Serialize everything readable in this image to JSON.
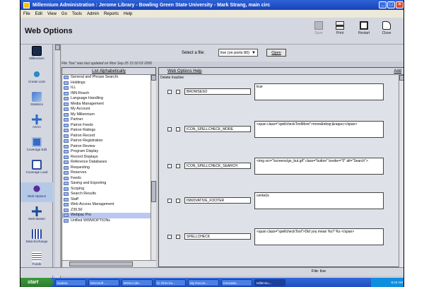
{
  "window": {
    "title": "Millennium Administration : Jerome Library - Bowling Green State University - Mark Strang, main circ"
  },
  "menu": [
    "File",
    "Edit",
    "View",
    "Go",
    "Tools",
    "Admin",
    "Reports",
    "Help"
  ],
  "header": {
    "page_title": "Web Options",
    "toolbar": [
      {
        "label": "Save",
        "icon": "save-icon",
        "enabled": false
      },
      {
        "label": "Print",
        "icon": "print-icon",
        "enabled": true
      },
      {
        "label": "Restart",
        "icon": "restart-icon",
        "enabled": true
      },
      {
        "label": "Close",
        "icon": "close-icon",
        "enabled": true
      }
    ]
  },
  "leftnav": [
    {
      "label": "Millennium",
      "icon": "millennium-logo-icon"
    },
    {
      "label": "Create Lists",
      "icon": "create-lists-icon"
    },
    {
      "label": "Statistics",
      "icon": "statistics-icon"
    },
    {
      "label": "ASAA",
      "icon": "asaa-icon"
    },
    {
      "label": "Coverage Edit",
      "icon": "coverage-edit-icon"
    },
    {
      "label": "Coverage Load",
      "icon": "coverage-load-icon"
    },
    {
      "label": "Web Options",
      "icon": "web-options-icon",
      "active": true
    },
    {
      "label": "Web Master",
      "icon": "web-master-icon"
    },
    {
      "label": "Data Exchange",
      "icon": "data-exchange-icon"
    },
    {
      "label": "Funds",
      "icon": "funds-icon"
    }
  ],
  "file_select": {
    "label": "Select a file:",
    "value": "live (on ports 80)",
    "open_label": "Open"
  },
  "last_updated": "File \"live\" was last updated on Mon Sep 25 15:32:03 2006",
  "list": {
    "header": "List Alphabetically",
    "items": [
      "General and Phrase Searchi",
      "Holdings",
      "ILL",
      "INN-Reach",
      "Language Handling",
      "Media Management",
      "My Account",
      "My Millennium",
      "Partner",
      "Patron Feeds",
      "Patron Ratings",
      "Patron Record",
      "Patron Registration",
      "Patron Review",
      "Program Display",
      "Record Displays",
      "Reference Databases",
      "Requesting",
      "Reserves",
      "Feeds",
      "Saving and Exporting",
      "Scoping",
      "Search Results",
      "Staff",
      "Web Access Management",
      "Z39.50",
      "Webpac Pro",
      "Unfiled WWWOPTIONs"
    ],
    "selected": "Webpac Pro"
  },
  "options": {
    "help_label": "Web Options Help",
    "add_label": "Add",
    "subheader": "Delete Inactive",
    "rows": [
      {
        "key": "BROWSESO",
        "value": "true"
      },
      {
        "key": "ICON_SPELLCHECK_MORE",
        "value": "<span class=\"spellcheckToolMore\">more&nbsp;&raquo;</span>"
      },
      {
        "key": "ICON_SPELLCHECK_SEARCH",
        "value": "<img src=\"/screens/go_but.gif\" class=\"button\" border=\"0\" alt=\"Search\">"
      },
      {
        "key": "INNOVATIVE_FOOTER",
        "value": "center|s"
      },
      {
        "key": "SPELLCHECK",
        "value": "<span class=\"spellcheckTool\">Did you mean %s? %s </span>"
      }
    ]
  },
  "status": {
    "file": "File: live"
  },
  "taskbar": {
    "start": "start",
    "tasks": [
      "Eudora",
      "Microsoft ...",
      "BGSU Libr...",
      "IC Ohio Do...",
      "My Docum...",
      "Innovativ...",
      "Millenniu..."
    ],
    "tray_time": "8:34 AM"
  }
}
